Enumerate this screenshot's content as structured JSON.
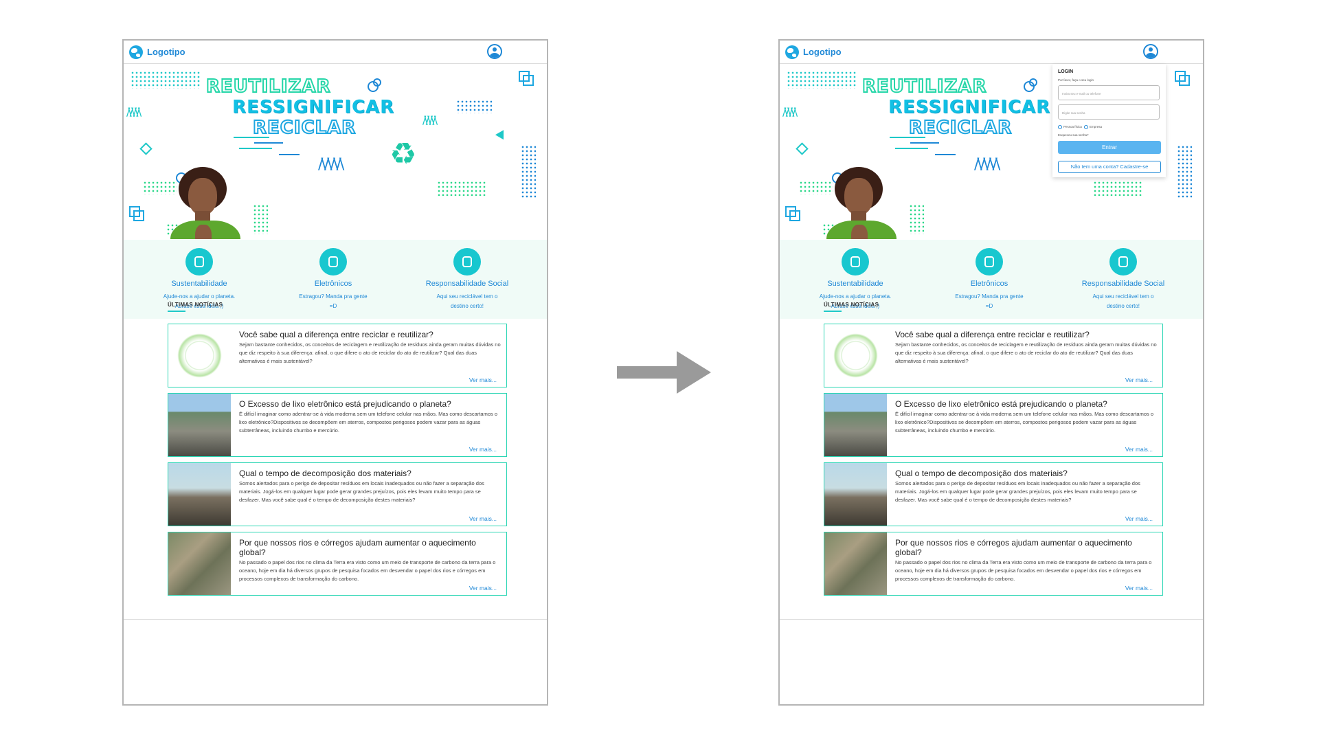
{
  "header": {
    "logo_text": "Logotipo",
    "logo_icon": "globe-icon",
    "user_icon": "user-icon"
  },
  "banner": {
    "words": [
      "REUTILIZAR",
      "RESSIGNIFICAR",
      "RECICLAR"
    ],
    "recycle_icon": "recycle-icon"
  },
  "categories": [
    {
      "icon": "plant-icon",
      "title": "Sustentabilidade",
      "desc": "Ajude-nos a ajudar o planeta. Abrace essa ideia ;)"
    },
    {
      "icon": "circuit-icon",
      "title": "Eletrônicos",
      "desc": "Estragou? Manda pra gente =D"
    },
    {
      "icon": "earth-hand-icon",
      "title": "Responsabilidade Social",
      "desc": "Aqui seu reciclável tem o destino certo!"
    }
  ],
  "news": {
    "heading": "ÚLTIMAS NOTÍCIAS",
    "more": "Ver mais...",
    "items": [
      {
        "title": "Você sabe qual a diferença entre reciclar e reutilizar?",
        "text": "Sejam bastante conhecidos, os conceitos de reciclagem e reutilização de resíduos ainda geram muitas dúvidas no que diz respeito à sua diferença: afinal, o que difere o ato de reciclar do ato de reutilizar? Qual das duas alternativas é mais sustentável?"
      },
      {
        "title": "O Excesso de lixo eletrônico está prejudicando o planeta?",
        "text": "É difícil imaginar como adentrar-se à vida moderna sem um telefone celular nas mãos. Mas como descartamos o lixo eletrônico?Dispositivos se decompõem em aterros, compostos perigosos podem vazar para as águas subterrâneas, incluindo chumbo e mercúrio."
      },
      {
        "title": "Qual o tempo de decomposição dos materiais?",
        "text": "Somos alertados para o perigo de depositar resíduos em locais inadequados ou não fazer a separação dos materiais. Jogá-los em qualquer lugar pode gerar grandes prejuízos, pois eles levam muito tempo para se desfazer. Mas você sabe qual é o tempo de decomposição destes materiais?"
      },
      {
        "title": "Por que nossos rios e córregos ajudam aumentar o aquecimento global?",
        "text": "No passado o papel dos rios no clima da Terra era visto como um meio de transporte de carbono da terra para o oceano, hoje em dia há diversos grupos de pesquisa focados em desvendar o papel dos rios e córregos em processos complexos de transformação do carbono."
      }
    ]
  },
  "login": {
    "title": "LOGIN",
    "subtitle": "Por favor, faça o seu login",
    "email_placeholder": "Insira seu e-mail ou telefone",
    "password_placeholder": "Digite sua senha",
    "radio_options": [
      "Pessoa física",
      "Empresa"
    ],
    "forgot": "Esqueceu sua senha?",
    "submit": "Entrar",
    "register": "Não tem uma conta? Cadastre-se"
  },
  "colors": {
    "accent": "#1ec8c8",
    "brand_blue": "#1e88d6",
    "green": "#2bd6b4",
    "button": "#5ab4f0"
  }
}
